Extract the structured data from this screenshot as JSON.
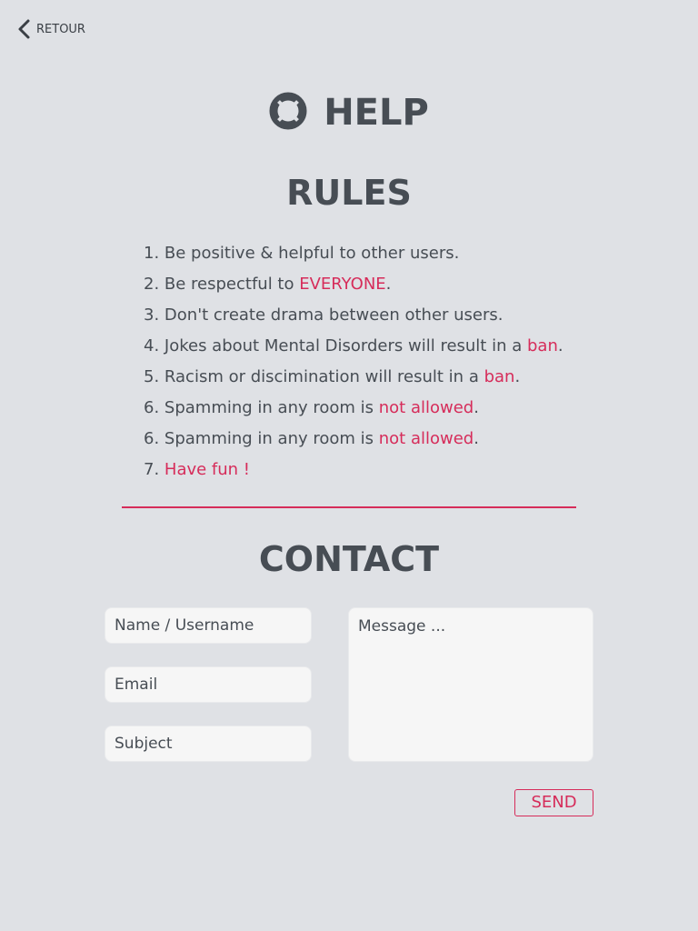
{
  "nav": {
    "back_label": "RETOUR",
    "back_icon": "chevron-left-icon"
  },
  "header": {
    "title": "HELP",
    "icon": "lifebuoy-icon"
  },
  "rules": {
    "title": "RULES",
    "items": [
      {
        "num": "1. ",
        "before": "Be positive & helpful to other users.",
        "highlight": "",
        "after": ""
      },
      {
        "num": "2. ",
        "before": "Be respectful to ",
        "highlight": "EVERYONE",
        "after": "."
      },
      {
        "num": "3. ",
        "before": "Don't create drama between other users.",
        "highlight": "",
        "after": ""
      },
      {
        "num": "4. ",
        "before": "Jokes about Mental Disorders will result in a ",
        "highlight": "ban",
        "after": "."
      },
      {
        "num": "5. ",
        "before": "Racism or discimination will result in a ",
        "highlight": "ban",
        "after": "."
      },
      {
        "num": "6. ",
        "before": "Spamming in any room is ",
        "highlight": "not allowed",
        "after": "."
      },
      {
        "num": "6. ",
        "before": "Spamming in any room is ",
        "highlight": "not allowed",
        "after": "."
      },
      {
        "num": "7. ",
        "before": "",
        "highlight": "Have fun !",
        "after": ""
      }
    ]
  },
  "contact": {
    "title": "CONTACT",
    "name_placeholder": "Name / Username",
    "email_placeholder": "Email",
    "subject_placeholder": "Subject",
    "message_placeholder": "Message ...",
    "send_label": "SEND"
  },
  "colors": {
    "background": "#dfe1e5",
    "text": "#474d54",
    "accent": "#d62c5a",
    "input_background": "#f6f6f6"
  }
}
